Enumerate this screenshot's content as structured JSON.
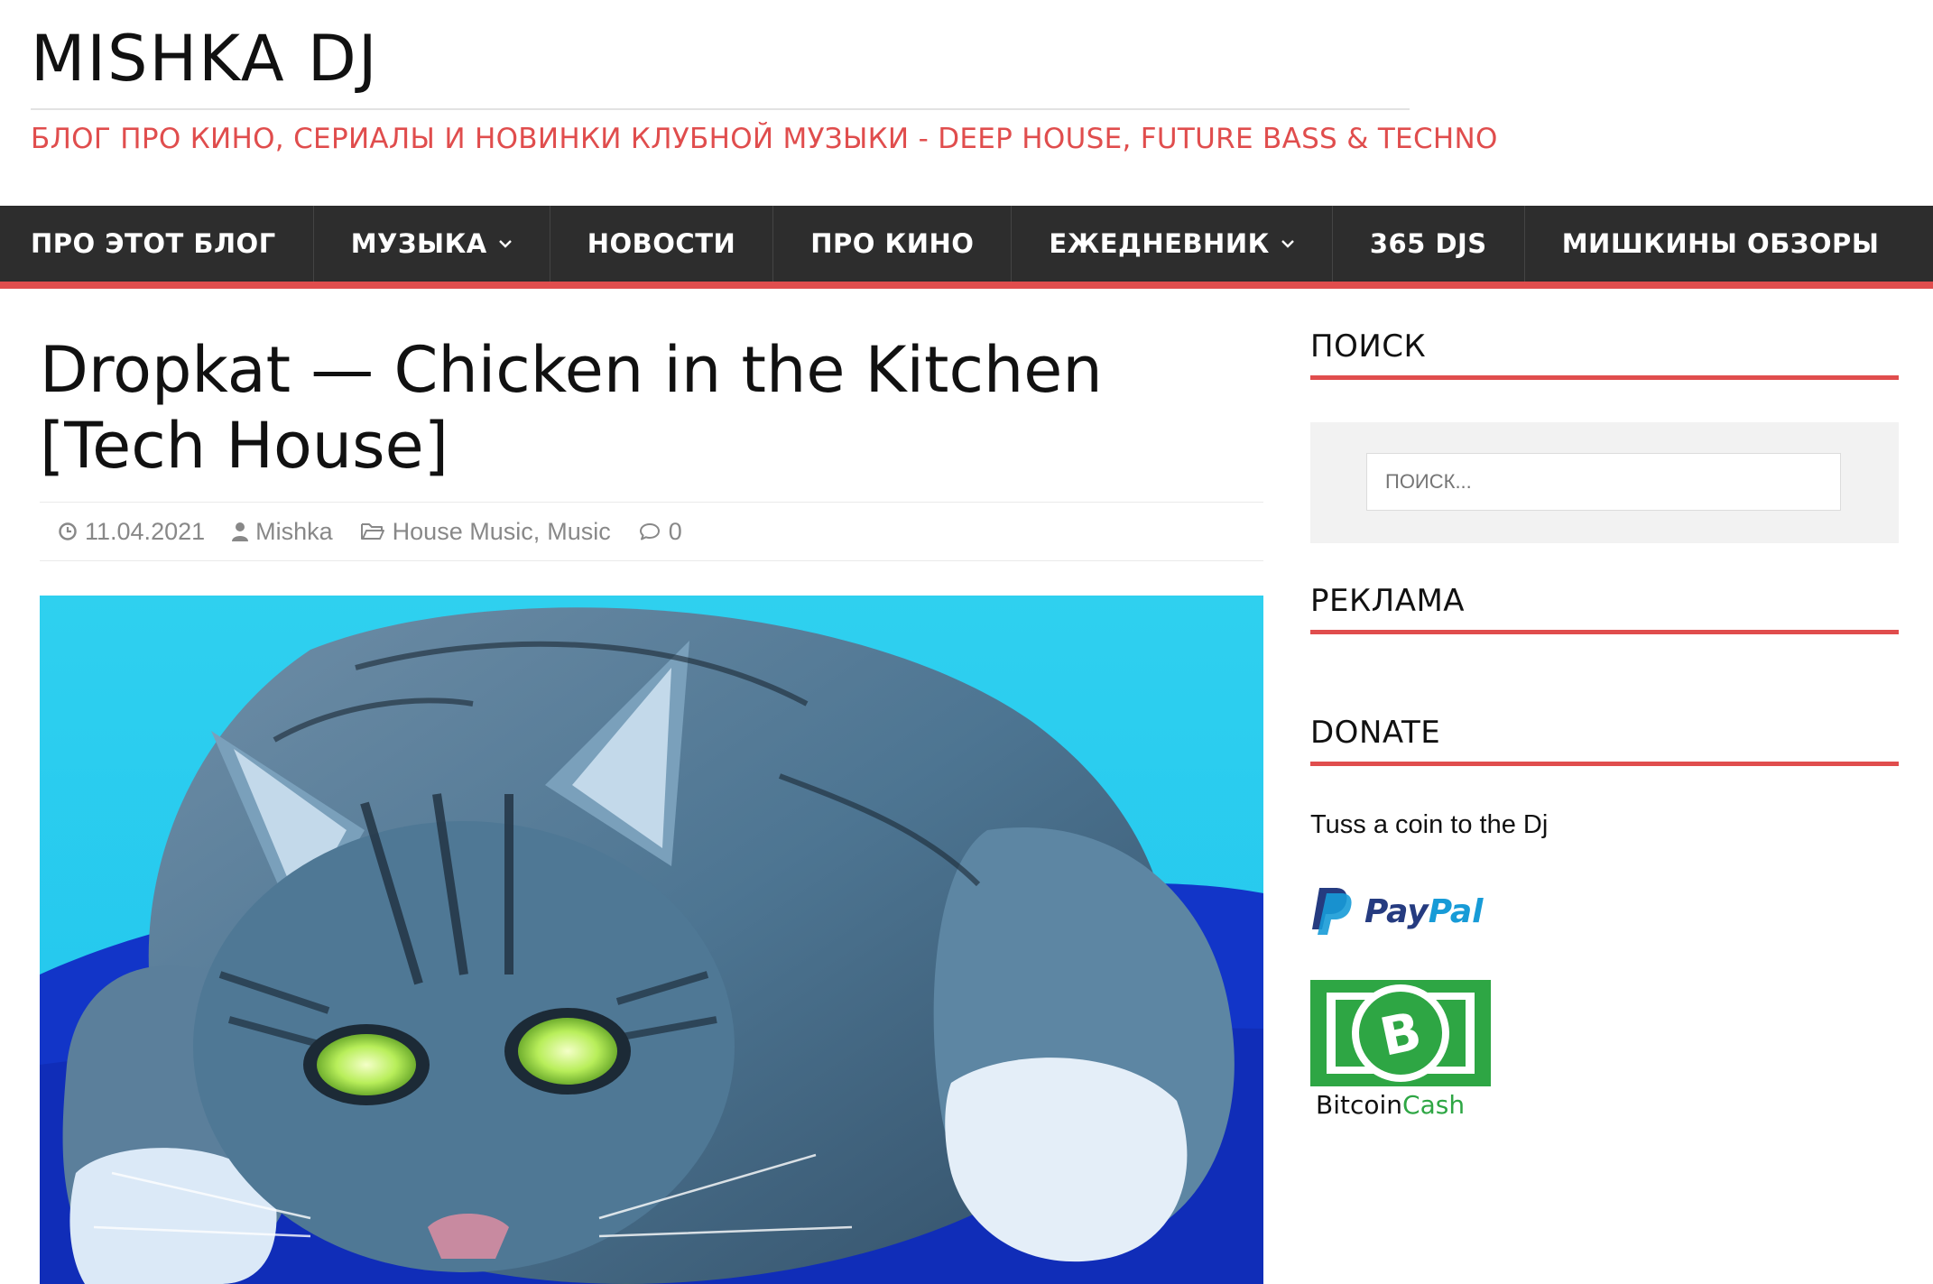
{
  "header": {
    "site_title": "MISHKA DJ",
    "site_description": "БЛОГ ПРО КИНО, СЕРИАЛЫ И НОВИНКИ КЛУБНОЙ МУЗЫКИ - DEEP HOUSE, FUTURE BASS & TECHNO"
  },
  "nav": {
    "items": [
      {
        "label": "ПРО ЭТОТ БЛОГ",
        "dropdown": false
      },
      {
        "label": "МУЗЫКА",
        "dropdown": true
      },
      {
        "label": "НОВОСТИ",
        "dropdown": false
      },
      {
        "label": "ПРО КИНО",
        "dropdown": false
      },
      {
        "label": "ЕЖЕДНЕВНИК",
        "dropdown": true
      },
      {
        "label": "365 DJS",
        "dropdown": false
      },
      {
        "label": "МИШКИНЫ ОБЗОРЫ",
        "dropdown": false
      }
    ]
  },
  "article": {
    "title": "Dropkat — Chicken in the Kitchen [Tech House]",
    "date": "11.04.2021",
    "author": "Mishka",
    "categories": [
      "House Music",
      "Music"
    ],
    "category_separator": ",",
    "comments": "0"
  },
  "sidebar": {
    "search_title": "ПОИСК",
    "search_placeholder": "ПОИСК...",
    "ads_title": "РЕКЛАМА",
    "donate_title": "DONATE",
    "donate_text": "Tuss a coin to the Dj",
    "paypal_logo": "PayPal",
    "bch_logo_a": "Bitcoin",
    "bch_logo_b": "Cash"
  },
  "colors": {
    "accent": "#e04d4d",
    "nav_bg": "#2d2d2d",
    "paypal_dark": "#253b80",
    "paypal_light": "#179bd7",
    "bch_green": "#2ea644"
  }
}
